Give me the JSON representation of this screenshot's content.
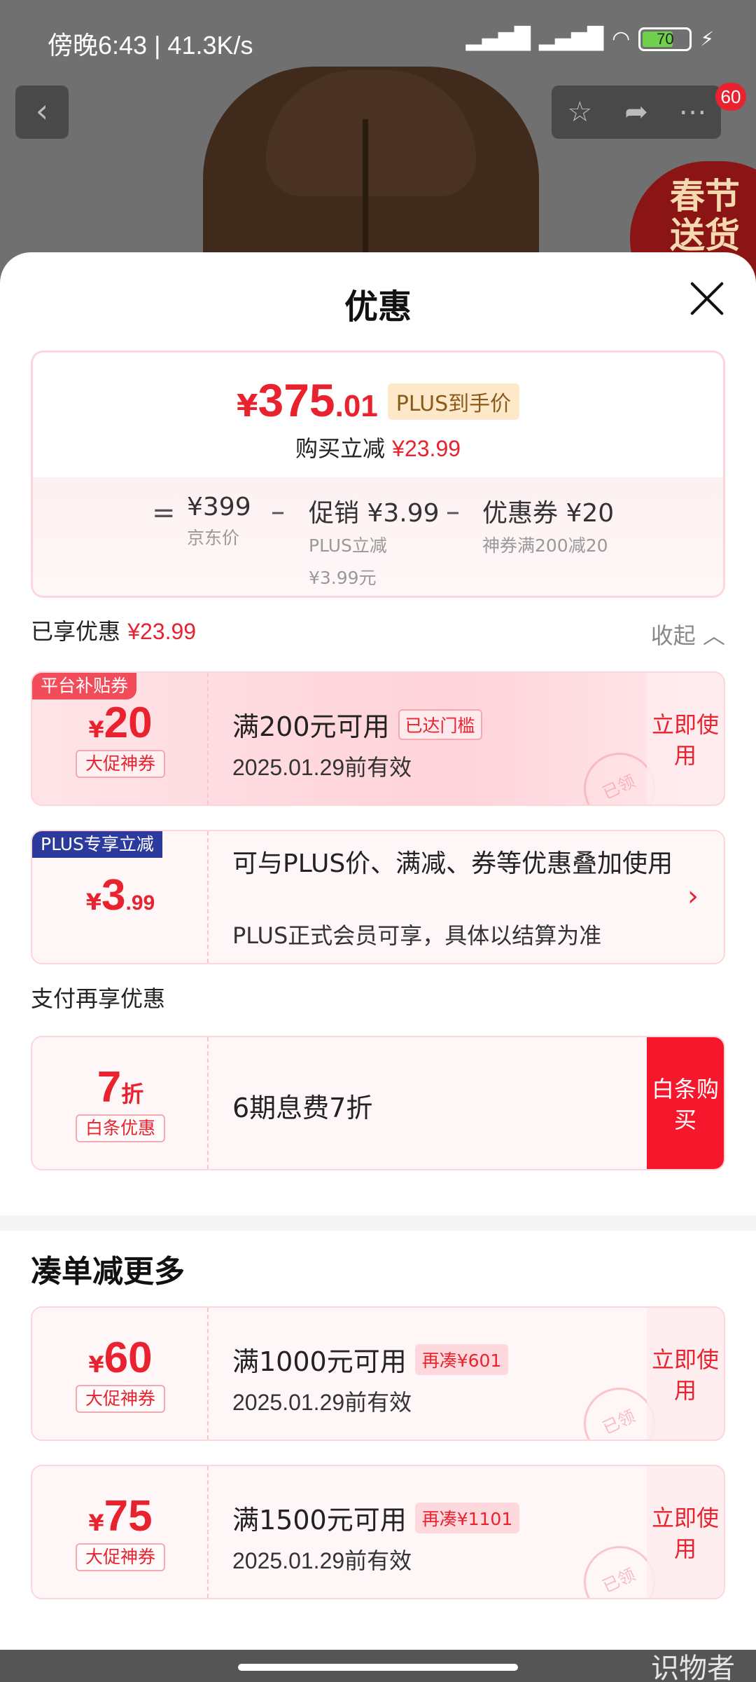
{
  "status": {
    "time": "傍晚6:43 | 41.3K/s",
    "signal1": "HD",
    "signal2": "HD",
    "battery": "70",
    "battery_level": 0.7
  },
  "product_bg": {
    "promo_text": "春节送货",
    "message_count": "60"
  },
  "sheet": {
    "title": "优惠"
  },
  "price": {
    "currency": "¥",
    "integer": "375",
    "decimal": ".01",
    "plus_tag": "PLUS到手价",
    "sub_label": "购买立减",
    "sub_amount": "¥23.99",
    "formula": {
      "eq": "=",
      "jd_value": "¥399",
      "jd_label": "京东价",
      "minus1": "–",
      "promo_value": "促销 ¥3.99",
      "promo_label": "PLUS立减",
      "promo_label2": "¥3.99元",
      "minus2": "–",
      "coupon_value": "优惠券 ¥20",
      "coupon_label": "神券满200减20"
    }
  },
  "enjoyed": {
    "label": "已享优惠",
    "amount": "¥23.99",
    "collapse": "收起"
  },
  "coupons": [
    {
      "corner": "平台补贴券",
      "currency": "¥",
      "amount": "20",
      "tag": "大促神券",
      "title": "满200元可用",
      "badge": "已达门槛",
      "date": "2025.01.29前有效",
      "action": "立即使用",
      "stamp": "已领"
    },
    {
      "corner": "PLUS专享立减",
      "currency": "¥",
      "amount": "3",
      "amount_dec": ".99",
      "desc": "可与PLUS价、满减、券等优惠叠加使用",
      "desc2": "PLUS正式会员可享，具体以结算为准",
      "arrow": "›"
    }
  ],
  "pay": {
    "label": "支付再享优惠",
    "amount": "7",
    "unit": "折",
    "tag": "白条优惠",
    "desc": "6期息费7折",
    "action": "白条购买"
  },
  "more": {
    "title": "凑单减更多",
    "items": [
      {
        "currency": "¥",
        "amount": "60",
        "tag": "大促神券",
        "title": "满1000元可用",
        "badge": "再凑¥601",
        "date": "2025.01.29前有效",
        "action": "立即使用",
        "stamp": "已领"
      },
      {
        "currency": "¥",
        "amount": "75",
        "tag": "大促神券",
        "title": "满1500元可用",
        "badge": "再凑¥1101",
        "date": "2025.01.29前有效",
        "action": "立即使用",
        "stamp": "已领"
      }
    ]
  },
  "watermark": "识物者"
}
